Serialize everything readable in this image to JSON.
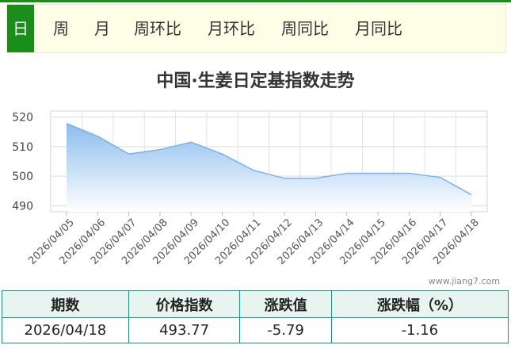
{
  "tabs": [
    {
      "label": "日",
      "active": true
    },
    {
      "label": "周"
    },
    {
      "label": "月"
    },
    {
      "label": "周环比"
    },
    {
      "label": "月环比"
    },
    {
      "label": "周同比"
    },
    {
      "label": "月同比"
    }
  ],
  "watermark": "www.jiang7.com",
  "chart_data": {
    "type": "area",
    "title": "中国·生姜日定基指数走势",
    "xlabel": "",
    "ylabel": "",
    "categories": [
      "2026/04/05",
      "2026/04/06",
      "2026/04/07",
      "2026/04/08",
      "2026/04/09",
      "2026/04/10",
      "2026/04/11",
      "2026/04/12",
      "2026/04/13",
      "2026/04/14",
      "2026/04/15",
      "2026/04/16",
      "2026/04/17",
      "2026/04/18"
    ],
    "values": [
      517.8,
      513.5,
      507.5,
      509,
      511.5,
      507.5,
      502,
      499.3,
      499.3,
      501,
      501,
      501,
      499.6,
      493.77
    ],
    "ylim": [
      488,
      522
    ],
    "yticks": [
      490,
      500,
      510,
      520
    ],
    "grid": true,
    "colors": {
      "line": "#80b0e6",
      "fill_top": "#8cbcee",
      "fill_bottom": "#ffffff"
    }
  },
  "table": {
    "headers": [
      "期数",
      "价格指数",
      "涨跌值",
      "涨跌幅（%）"
    ],
    "row": [
      "2026/04/18",
      "493.77",
      "-5.79",
      "-1.16"
    ]
  },
  "colors": {
    "accent": "#1a8e1a",
    "tab_bg": "#fefde6",
    "table_border": "#1a8e8e",
    "table_header_bg": "#e8f4ef"
  }
}
